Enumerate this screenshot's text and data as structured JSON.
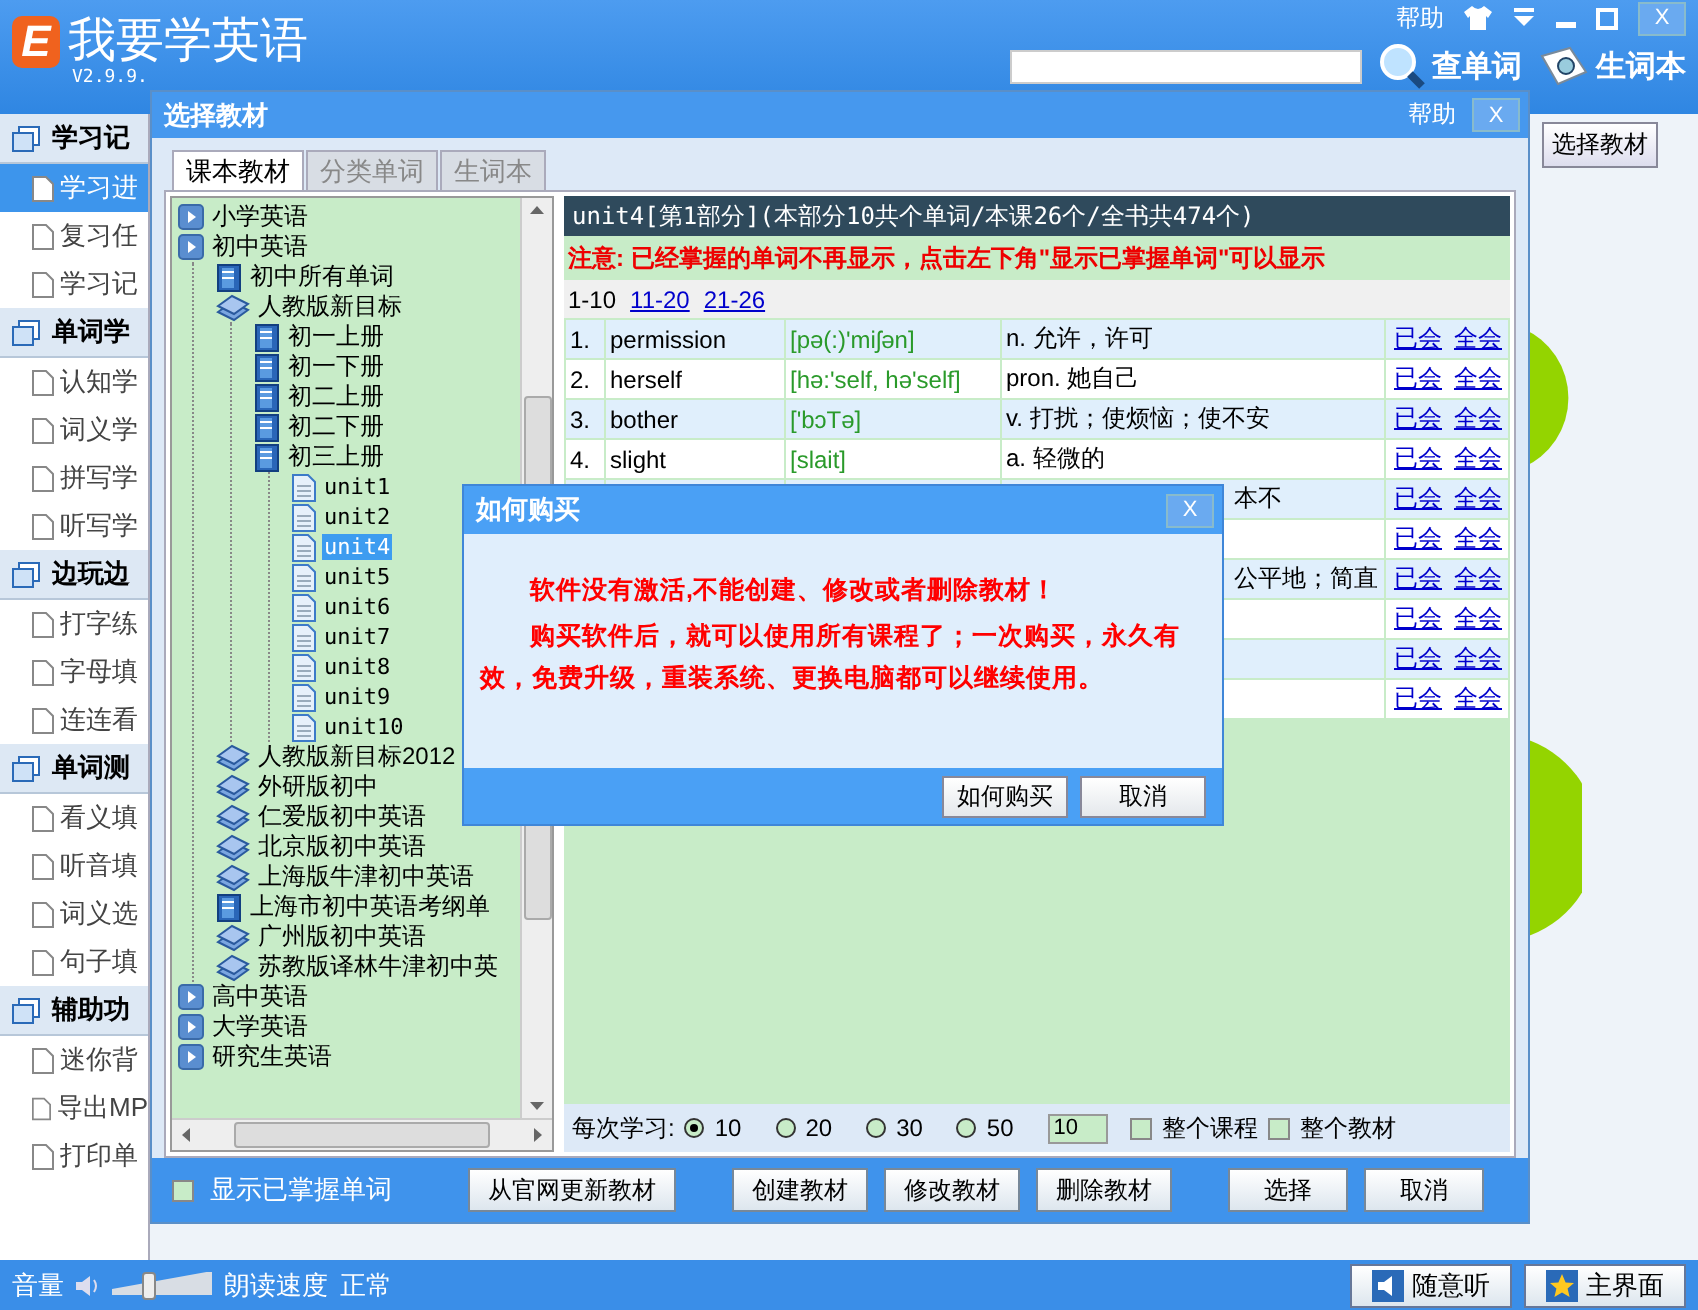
{
  "app": {
    "logo_letter": "E",
    "title": "我要学英语",
    "version": "V2.9.9.",
    "help": "帮助",
    "close": "X",
    "search": {
      "button": "查单词"
    },
    "notebook": "生词本",
    "side_button": "选择教材"
  },
  "sidebar": [
    {
      "title": "学习记",
      "items": [
        {
          "label": "学习进",
          "selected": true
        },
        {
          "label": "复习任",
          "selected": false
        },
        {
          "label": "学习记",
          "selected": false
        }
      ]
    },
    {
      "title": "单词学",
      "items": [
        {
          "label": "认知学",
          "selected": false
        },
        {
          "label": "词义学",
          "selected": false
        },
        {
          "label": "拼写学",
          "selected": false
        },
        {
          "label": "听写学",
          "selected": false
        }
      ]
    },
    {
      "title": "边玩边",
      "items": [
        {
          "label": "打字练",
          "selected": false
        },
        {
          "label": "字母填",
          "selected": false
        },
        {
          "label": "连连看",
          "selected": false
        }
      ]
    },
    {
      "title": "单词测",
      "items": [
        {
          "label": "看义填",
          "selected": false
        },
        {
          "label": "听音填",
          "selected": false
        },
        {
          "label": "词义选",
          "selected": false
        },
        {
          "label": "句子填",
          "selected": false
        }
      ]
    },
    {
      "title": "辅助功",
      "items": [
        {
          "label": "迷你背",
          "selected": false
        },
        {
          "label": "导出MP",
          "selected": false
        },
        {
          "label": "打印单",
          "selected": false
        }
      ]
    }
  ],
  "status_bar": {
    "volume_label": "音量",
    "volume": {
      "level": 0.35
    },
    "speed_label": "朗读速度",
    "speed_value": "正常",
    "buttons": [
      {
        "label": "随意听",
        "kind": "speaker"
      },
      {
        "label": "主界面",
        "kind": "star"
      }
    ]
  },
  "textbook_dialog": {
    "title": "选择教材",
    "help": "帮助",
    "close": "X",
    "tabs": [
      {
        "label": "课本教材",
        "selected": true
      },
      {
        "label": "分类单词",
        "selected": false
      },
      {
        "label": "生词本",
        "selected": false
      }
    ],
    "tree": [
      {
        "label": "小学英语",
        "kind": "category",
        "selected": false
      },
      {
        "label": "初中英语",
        "kind": "category",
        "selected": false,
        "children": [
          {
            "label": "初中所有单词",
            "kind": "book",
            "selected": false
          },
          {
            "label": "人教版新目标",
            "kind": "books",
            "selected": false,
            "children": [
              {
                "label": "初一上册",
                "kind": "book",
                "selected": false
              },
              {
                "label": "初一下册",
                "kind": "book",
                "selected": false
              },
              {
                "label": "初二上册",
                "kind": "book",
                "selected": false
              },
              {
                "label": "初二下册",
                "kind": "book",
                "selected": false
              },
              {
                "label": "初三上册",
                "kind": "book",
                "selected": false,
                "children": [
                  {
                    "label": "unit1",
                    "kind": "unit",
                    "selected": false
                  },
                  {
                    "label": "unit2",
                    "kind": "unit",
                    "selected": false
                  },
                  {
                    "label": "unit4",
                    "kind": "unit",
                    "selected": true
                  },
                  {
                    "label": "unit5",
                    "kind": "unit",
                    "selected": false
                  },
                  {
                    "label": "unit6",
                    "kind": "unit",
                    "selected": false
                  },
                  {
                    "label": "unit7",
                    "kind": "unit",
                    "selected": false
                  },
                  {
                    "label": "unit8",
                    "kind": "unit",
                    "selected": false
                  },
                  {
                    "label": "unit9",
                    "kind": "unit",
                    "selected": false
                  },
                  {
                    "label": "unit10",
                    "kind": "unit",
                    "selected": false
                  }
                ]
              }
            ]
          },
          {
            "label": "人教版新目标2012",
            "kind": "books",
            "selected": false
          },
          {
            "label": "外研版初中",
            "kind": "books",
            "selected": false
          },
          {
            "label": "仁爱版初中英语",
            "kind": "books",
            "selected": false
          },
          {
            "label": "北京版初中英语",
            "kind": "books",
            "selected": false
          },
          {
            "label": "上海版牛津初中英语",
            "kind": "books",
            "selected": false
          },
          {
            "label": "上海市初中英语考纲单",
            "kind": "book",
            "selected": false
          },
          {
            "label": "广州版初中英语",
            "kind": "books",
            "selected": false
          },
          {
            "label": "苏教版译林牛津初中英",
            "kind": "books",
            "selected": false
          }
        ]
      },
      {
        "label": "高中英语",
        "kind": "category",
        "selected": false
      },
      {
        "label": "大学英语",
        "kind": "category",
        "selected": false
      },
      {
        "label": "研究生英语",
        "kind": "category",
        "selected": false
      }
    ],
    "header": "unit4[第1部分](本部分10共个单词/本课26个/全书共474个)",
    "notice": "注意: 已经掌握的单词不再显示，点击左下角\"显示已掌握单词\"可以显示",
    "pages": [
      {
        "label": "1-10",
        "selected": true
      },
      {
        "label": "11-20",
        "selected": false
      },
      {
        "label": "21-26",
        "selected": false
      }
    ],
    "words": [
      {
        "number": "1.",
        "word": "permission",
        "phonetic": "[pə(:)'miʃən]",
        "meaning": "n. 允许，许可",
        "actions": [
          "已会",
          "全会"
        ]
      },
      {
        "number": "2.",
        "word": "herself",
        "phonetic": "[hə:'self, hə'self]",
        "meaning": "pron. 她自己",
        "actions": [
          "已会",
          "全会"
        ]
      },
      {
        "number": "3.",
        "word": "bother",
        "phonetic": "['bɔTə]",
        "meaning": "v. 打扰；使烦恼；使不安",
        "actions": [
          "已会",
          "全会"
        ]
      },
      {
        "number": "4.",
        "word": "slight",
        "phonetic": "[slait]",
        "meaning": "a. 轻微的",
        "actions": [
          "已会",
          "全会"
        ]
      },
      {
        "meaning": "本不",
        "actions": [
          "已会",
          "全会"
        ]
      },
      {
        "actions": [
          "已会",
          "全会"
        ]
      },
      {
        "meaning": "公平地；简直",
        "actions": [
          "已会",
          "全会"
        ]
      },
      {
        "actions": [
          "已会",
          "全会"
        ]
      },
      {
        "actions": [
          "已会",
          "全会"
        ]
      },
      {
        "actions": [
          "已会",
          "全会"
        ]
      }
    ],
    "per_study": {
      "label": "每次学习:",
      "options": [
        {
          "label": "10",
          "selected": true
        },
        {
          "label": "20",
          "selected": false
        },
        {
          "label": "30",
          "selected": false
        },
        {
          "label": "50",
          "selected": false
        }
      ],
      "count": "10",
      "checks": [
        {
          "label": "整个课程",
          "checked": false
        },
        {
          "label": "整个教材",
          "checked": false
        }
      ]
    },
    "show_mastered": {
      "label": "显示已掌握单词",
      "checked": false
    },
    "buttons": [
      "从官网更新教材",
      "创建教材",
      "修改教材",
      "删除教材",
      "选择",
      "取消"
    ]
  },
  "purchase_dialog": {
    "title": "如何购买",
    "close": "X",
    "messages": [
      "软件没有激活,不能创建、修改或者删除教材！",
      "购买软件后，就可以使用所有课程了；一次购买，永久有效，免费升级，重装系统、更换电脑都可以继续使用。"
    ],
    "buttons": [
      "如何购买",
      "取消"
    ]
  }
}
